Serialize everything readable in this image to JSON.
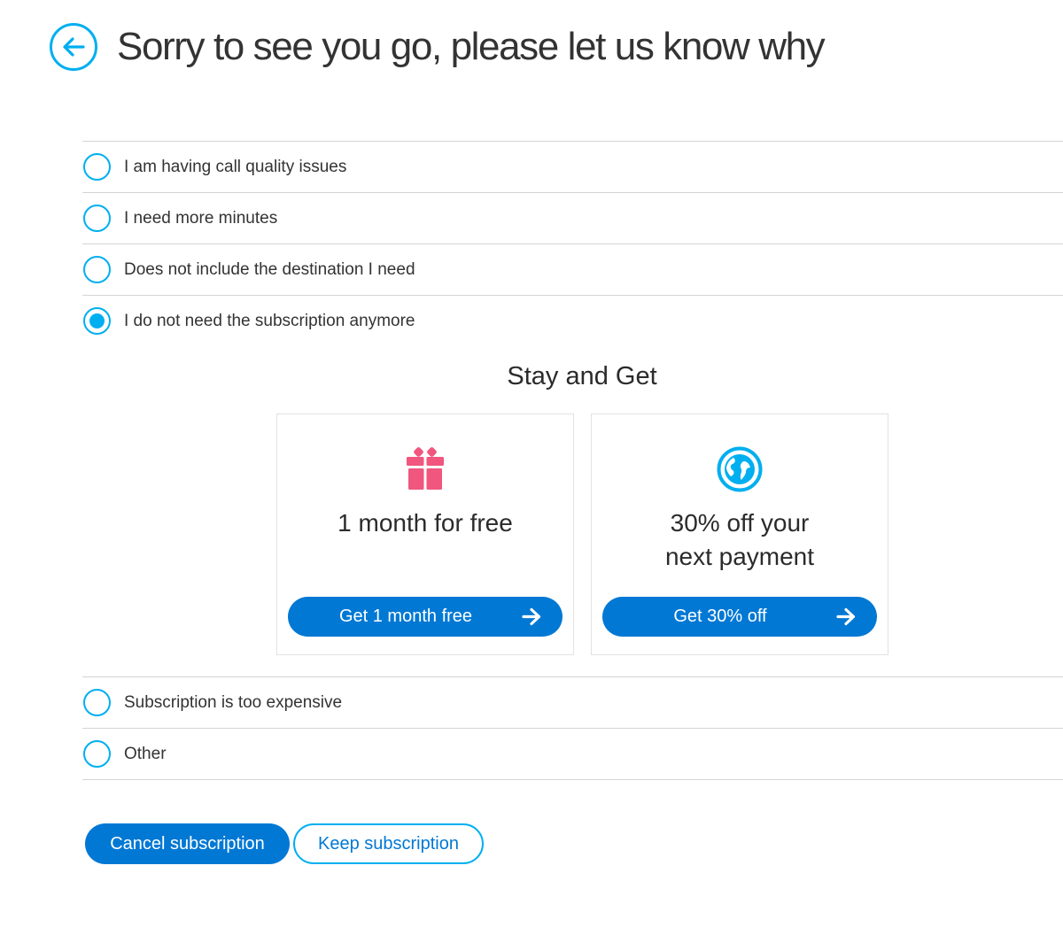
{
  "header": {
    "back_icon": "arrow-left-icon",
    "title": "Sorry to see you go, please let us know why"
  },
  "reasons": [
    {
      "label": "I am having call quality issues",
      "selected": false
    },
    {
      "label": "I need more minutes",
      "selected": false
    },
    {
      "label": "Does not include the destination I need",
      "selected": false
    },
    {
      "label": "I do not need the subscription anymore",
      "selected": true
    },
    {
      "label": "Subscription is too expensive",
      "selected": false
    },
    {
      "label": "Other",
      "selected": false
    }
  ],
  "offer": {
    "heading": "Stay and Get",
    "cards": [
      {
        "icon": "gift-icon",
        "icon_color": "#f0567e",
        "text": "1 month for free",
        "button_label": "Get 1 month free"
      },
      {
        "icon": "globe-icon",
        "icon_color": "#00aff0",
        "text_line1": "30% off your",
        "text_line2": "next payment",
        "button_label": "Get 30% off"
      }
    ]
  },
  "actions": {
    "cancel_label": "Cancel subscription",
    "keep_label": "Keep subscription"
  },
  "colors": {
    "accent": "#00aff0",
    "primary_button": "#0078d4",
    "divider": "#d4d4d4"
  }
}
